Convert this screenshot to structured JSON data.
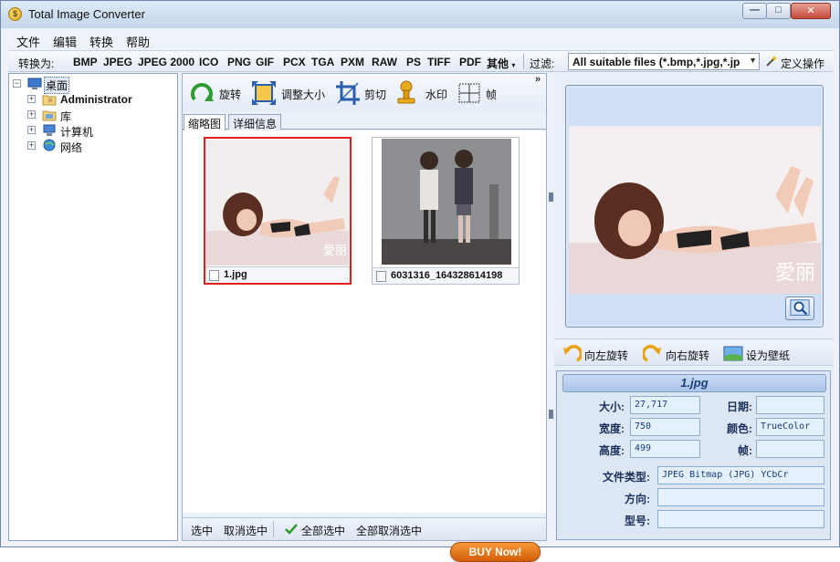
{
  "window": {
    "title": "Total Image Converter"
  },
  "menu": [
    "文件",
    "编辑",
    "转换",
    "帮助"
  ],
  "formatbar": {
    "convert_label": "转换为:",
    "formats": [
      "BMP",
      "JPEG",
      "JPEG 2000",
      "ICO",
      "PNG",
      "GIF",
      "PCX",
      "TGA",
      "PXM",
      "RAW",
      "PS",
      "TIFF",
      "PDF"
    ],
    "other_label": "其他",
    "filter_label": "过滤:",
    "filter_value": "All suitable files (*.bmp,*.jpg,*.jp",
    "custom_action_label": "定义操作"
  },
  "tree": {
    "root": "桌面",
    "items": [
      "Administrator",
      "库",
      "计算机",
      "网络"
    ]
  },
  "toolbar": {
    "rotate": "旋转",
    "resize": "调整大小",
    "crop": "剪切",
    "watermark": "水印",
    "frame": "帧"
  },
  "tabs": [
    "缩略图",
    "详细信息"
  ],
  "thumbnails": [
    {
      "filename": "1.jpg",
      "selected": true
    },
    {
      "filename": "6031316_164328614198",
      "selected": false
    }
  ],
  "buy_now": "BUY Now!",
  "bottombar": {
    "select": "选中",
    "deselect": "取消选中",
    "select_all": "全部选中",
    "deselect_all": "全部取消选中"
  },
  "preview_actions": {
    "rotate_left": "向左旋转",
    "rotate_right": "向右旋转",
    "set_wallpaper": "设为壁纸"
  },
  "info": {
    "filename": "1.jpg",
    "size_label": "大小:",
    "size_value": "27,717",
    "date_label": "日期:",
    "date_value": "",
    "width_label": "宽度:",
    "width_value": "750",
    "color_label": "颜色:",
    "color_value": "TrueColor",
    "height_label": "高度:",
    "height_value": "499",
    "frames_label": "帧:",
    "frames_value": "",
    "filetype_label": "文件类型:",
    "filetype_value": "JPEG Bitmap (JPG) YCbCr",
    "orientation_label": "方向:",
    "orientation_value": "",
    "model_label": "型号:",
    "model_value": ""
  },
  "colors": {
    "selection_border": "#e01c1c",
    "buy_now": "#e8761d",
    "info_text": "#1c2f58"
  }
}
